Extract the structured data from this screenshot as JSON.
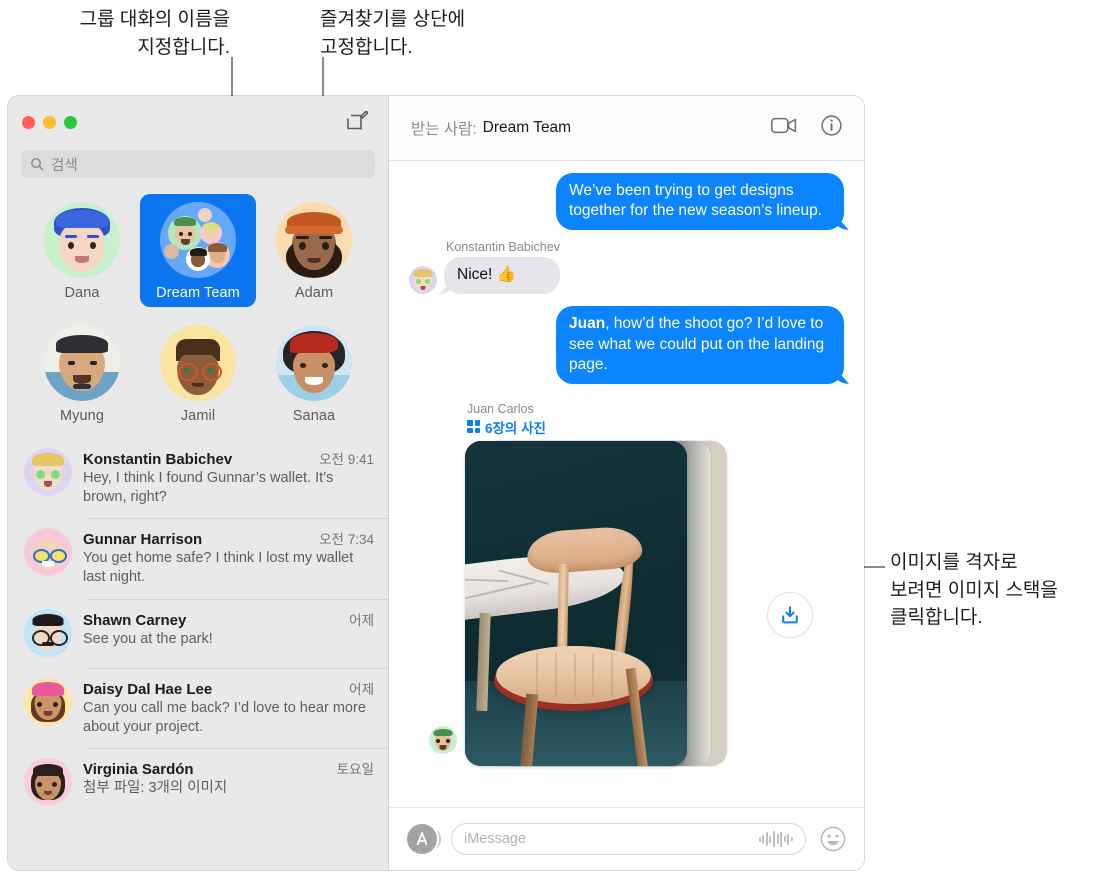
{
  "callouts": {
    "left": "그룹 대화의 이름을\n지정합니다.",
    "middle": "즐겨찾기를 상단에\n고정합니다.",
    "right": "이미지를 격자로\n보려면 이미지 스택을\n클릭합니다."
  },
  "sidebar": {
    "window_controls": [
      "close",
      "minimize",
      "zoom"
    ],
    "compose_icon": "compose-icon",
    "search": {
      "placeholder": "검색",
      "icon": "search-icon"
    },
    "pinned": [
      {
        "name": "Dana",
        "selected": false
      },
      {
        "name": "Dream Team",
        "selected": true
      },
      {
        "name": "Adam",
        "selected": false
      },
      {
        "name": "Myung",
        "selected": false
      },
      {
        "name": "Jamil",
        "selected": false
      },
      {
        "name": "Sanaa",
        "selected": false
      }
    ],
    "conversations": [
      {
        "name": "Konstantin Babichev",
        "time": "오전 9:41",
        "snippet": "Hey, I think I found Gunnar’s wallet. It’s brown, right?"
      },
      {
        "name": "Gunnar Harrison",
        "time": "오전 7:34",
        "snippet": "You get home safe? I think I lost my wallet last night."
      },
      {
        "name": "Shawn Carney",
        "time": "어제",
        "snippet": "See you at the park!"
      },
      {
        "name": "Daisy Dal Hae Lee",
        "time": "어제",
        "snippet": "Can you call me back? I’d love to hear more about your project."
      },
      {
        "name": "Virginia Sardón",
        "time": "토요일",
        "snippet": "첨부 파일: 3개의 이미지"
      }
    ]
  },
  "pane": {
    "to_label": "받는 사람:",
    "to_value": "Dream Team",
    "facetime_icon": "video-camera-icon",
    "info_icon": "info-circle-icon",
    "messages": [
      {
        "direction": "out",
        "text": "We’ve been trying to get designs together for the new season’s lineup."
      },
      {
        "direction": "in",
        "sender": "Konstantin Babichev",
        "text": "Nice!  👍"
      },
      {
        "direction": "out",
        "mention": "Juan",
        "text": ", how’d the shoot go? I’d love to see what we could put on the landing page."
      }
    ],
    "photo_stack": {
      "sender": "Juan Carlos",
      "count_label": "6장의 사진",
      "grid_icon": "grid-icon",
      "download_icon": "download-icon"
    },
    "composer": {
      "apps_icon": "app-store-icon",
      "placeholder": "iMessage",
      "audio_icon": "audio-waveform-icon",
      "emoji_icon": "smiley-icon"
    }
  },
  "colors": {
    "accent_blue": "#0b84fe",
    "selected_blue": "#0b76ef",
    "bubble_gray": "#e6e5eb",
    "sidebar_bg": "#e9e9e9"
  }
}
